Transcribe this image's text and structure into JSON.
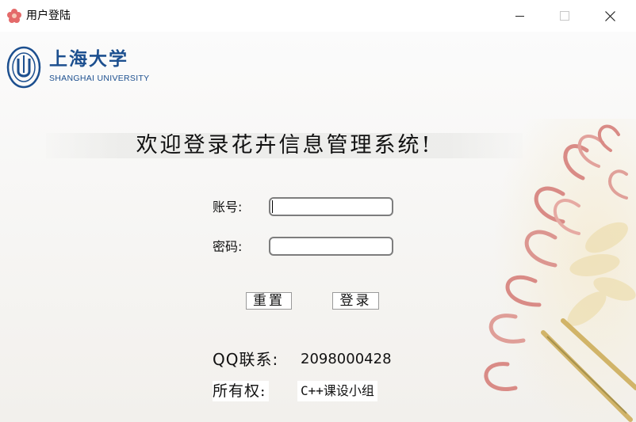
{
  "window": {
    "title": "用户登陆",
    "icon": "flower-app-icon"
  },
  "logo": {
    "name_cn": "上海大学",
    "name_en": "SHANGHAI UNIVERSITY"
  },
  "welcome_text": "欢迎登录花卉信息管理系统!",
  "form": {
    "account_label": "账号:",
    "account_value": "",
    "password_label": "密码:",
    "password_value": ""
  },
  "buttons": {
    "reset_label": "重置",
    "login_label": "登录"
  },
  "contact": {
    "label": "QQ联系:",
    "value": "2098000428"
  },
  "owner": {
    "label": "所有权:",
    "value": "C++课设小组"
  },
  "colors": {
    "brand_blue": "#1c4f8f",
    "petal_pink": "#d98b86",
    "input_border": "#7d7d7d"
  }
}
